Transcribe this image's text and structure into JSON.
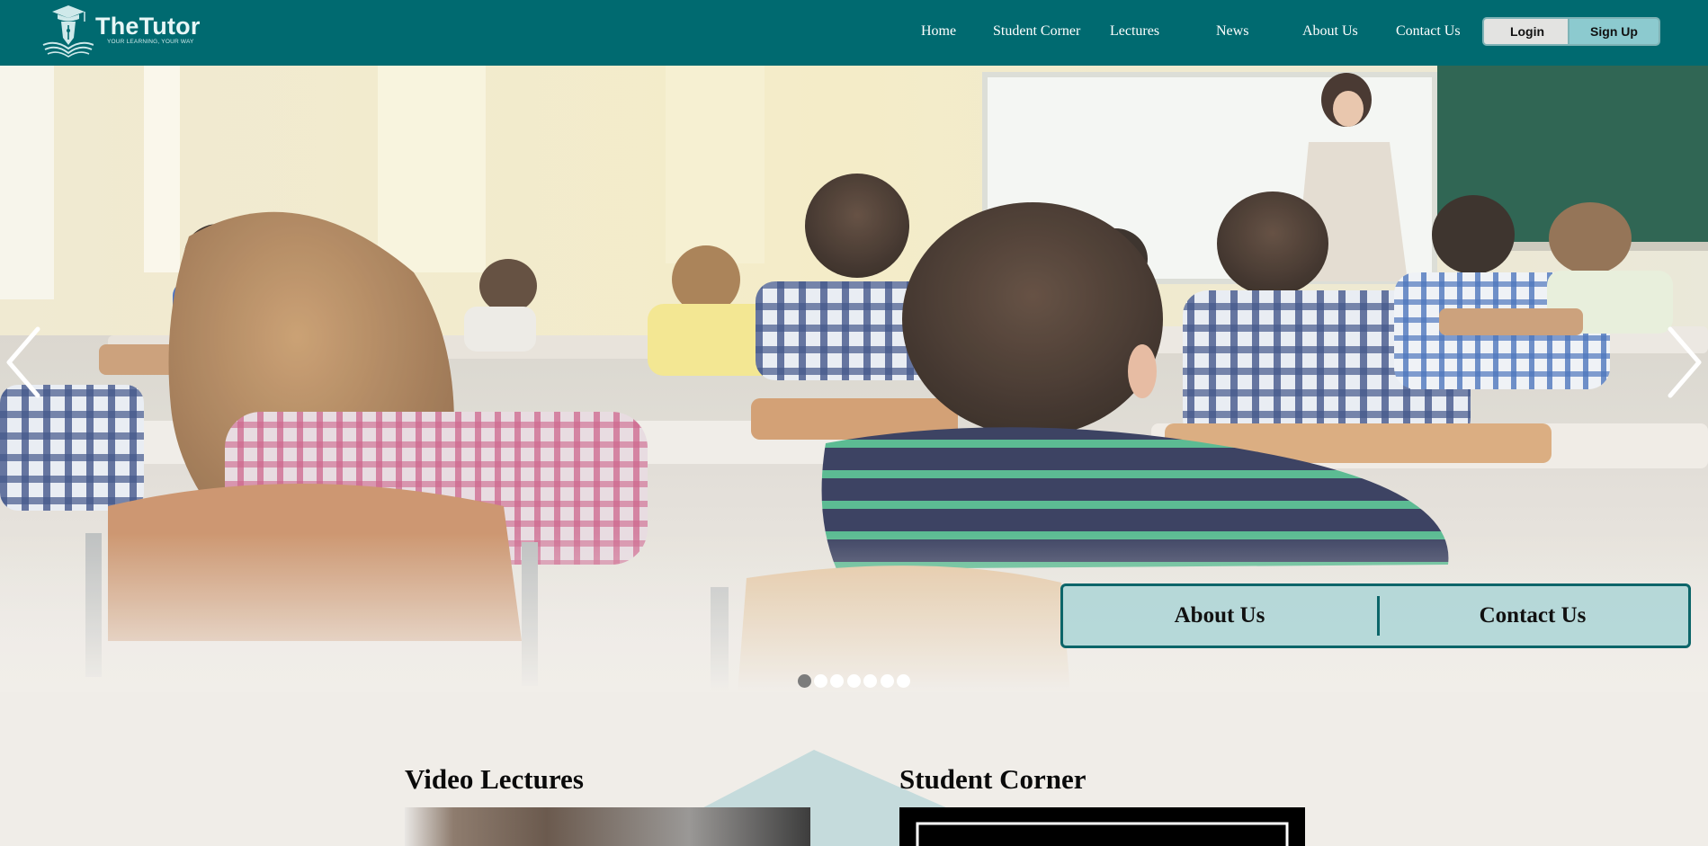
{
  "brand": {
    "name": "TheTutor",
    "tagline": "YOUR LEARNING, YOUR WAY",
    "colors": {
      "primary": "#006a70",
      "accent": "#8ccacf",
      "background": "#f0ede8"
    }
  },
  "nav": {
    "links": [
      "Home",
      "Student Corner",
      "Lectures",
      "News",
      "About Us",
      "Contact Us"
    ],
    "login_label": "Login",
    "signup_label": "Sign Up"
  },
  "hero": {
    "image": "classroom-photo",
    "prev_icon": "chevron-left-icon",
    "next_icon": "chevron-right-icon",
    "quick_links": {
      "about_label": "About Us",
      "contact_label": "Contact Us"
    },
    "slide_count": 7,
    "active_slide": 1
  },
  "sections": {
    "video_lectures": {
      "title": "Video Lectures"
    },
    "student_corner": {
      "title": "Student Corner"
    }
  }
}
